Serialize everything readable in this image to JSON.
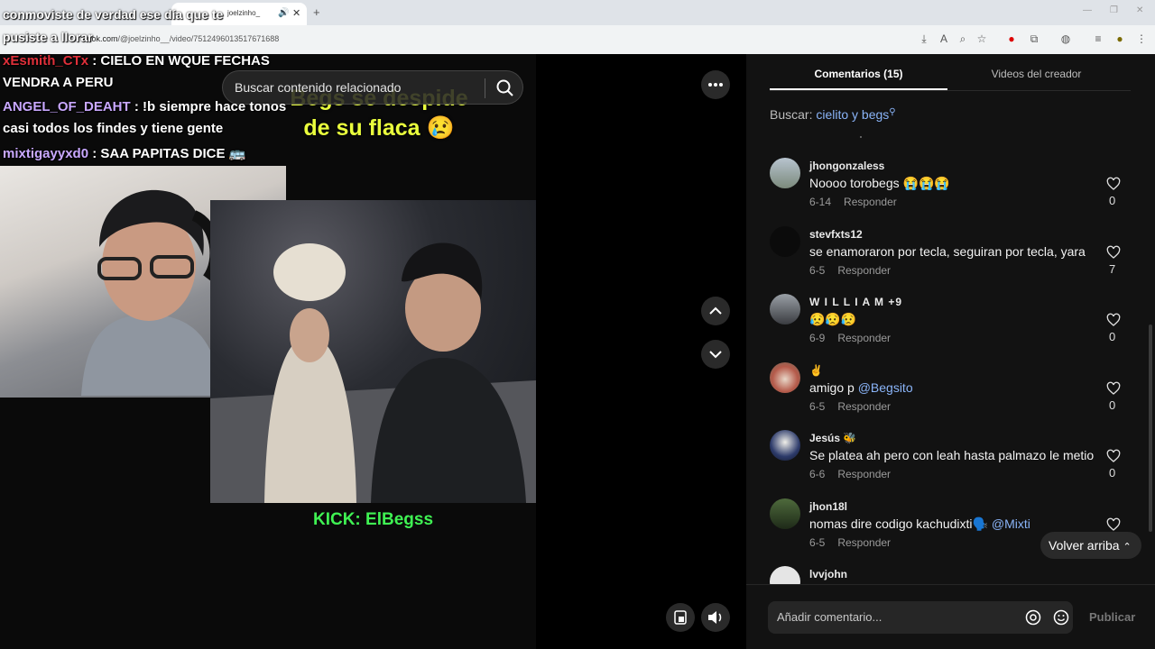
{
  "browser": {
    "tab_label": "joelzinho_",
    "address_domain": "tiktok.com",
    "address_path": "/@joelzinho__/video/7512496013517671688",
    "new_tab": "+"
  },
  "chat": {
    "caption_line1": "conmoviste de verdad ese día que te",
    "caption_line2": "pusiste a llorar",
    "msgs": [
      {
        "user": "xEsmith_CTx",
        "text": ": CIELO EN WQUE FECHAS"
      },
      {
        "user": "",
        "text": "VENDRA A PERU"
      },
      {
        "user": "ANGEL_OF_DEAHT",
        "text": ": !b siempre hace tonos"
      },
      {
        "user": "",
        "text": "casi todos los findes y tiene gente"
      },
      {
        "user": "mixtigayyxd0",
        "text": ": SAA PAPITAS DICE 🚌"
      }
    ]
  },
  "video": {
    "title_line1": "Begs se despide",
    "title_line2": "de su flaca 😢",
    "kick": "KICK: ElBegss",
    "search_placeholder": "Buscar contenido relacionado"
  },
  "panel": {
    "tab_comments": "Comentarios (15)",
    "tab_videos": "Videos del creador",
    "search_prefix": "Buscar:",
    "search_query": "cielito y begs",
    "reply_label": "Responder",
    "back_to_top": "Volver arriba",
    "composer_placeholder": "Añadir comentario...",
    "publish": "Publicar"
  },
  "comments": [
    {
      "user": "jhongonzaless",
      "text": "Noooo torobegs 😭😭😭",
      "mention": "",
      "date": "6-14",
      "likes": "0"
    },
    {
      "user": "stevfxts12",
      "text": "se enamoraron por tecla, seguiran por tecla, yara",
      "mention": "",
      "date": "6-5",
      "likes": "7"
    },
    {
      "user": "W I L L I A M +9",
      "text": "😥😥😥",
      "mention": "",
      "date": "6-9",
      "likes": "0"
    },
    {
      "user": "✌️",
      "text": "amigo p ",
      "mention": "@Begsito",
      "date": "6-5",
      "likes": "0"
    },
    {
      "user": "Jesús 🐝",
      "text": "Se platea ah pero con leah hasta palmazo le metio",
      "mention": "",
      "date": "6-6",
      "likes": "0"
    },
    {
      "user": "jhon18l",
      "text": "nomas dire codigo kachudixti🗣️ ",
      "mention": "@Mixti",
      "date": "6-5",
      "likes": ""
    },
    {
      "user": "lvvjohn",
      "text": "",
      "mention": "",
      "date": "",
      "likes": ""
    }
  ],
  "colors": {
    "chat_user_red": "#e0303a",
    "chat_user_violet": "#c9a8ff",
    "clip_title": "#eaff3d",
    "kick_green": "#3ff253",
    "mention": "#8ab4f8"
  }
}
